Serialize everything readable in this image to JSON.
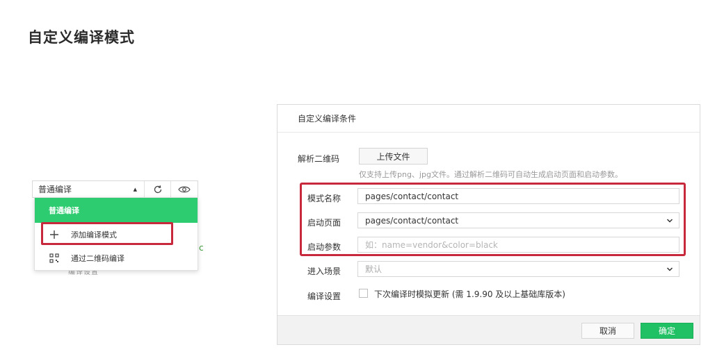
{
  "slide": {
    "title": "自定义编译模式"
  },
  "mini_toolbar": {
    "select_value": "普通编译",
    "icons": [
      "caret-up-icon",
      "refresh-icon",
      "eye-icon"
    ]
  },
  "dropdown": {
    "items": [
      {
        "label": "普通编译",
        "icon": ""
      },
      {
        "label": "添加编译模式",
        "icon": "plus-icon"
      },
      {
        "label": "通过二维码编译",
        "icon": "qrcode-icon"
      }
    ],
    "behind_text": "编译设置",
    "behind_green": "c"
  },
  "dialog": {
    "title": "自定义编译条件",
    "qrcode": {
      "label": "解析二维码",
      "upload_label": "上传文件",
      "hint": "仅支持上传png、jpg文件。通过解析二维码可自动生成启动页面和启动参数。"
    },
    "mode_name": {
      "label": "模式名称",
      "value": "pages/contact/contact"
    },
    "start_page": {
      "label": "启动页面",
      "value": "pages/contact/contact"
    },
    "start_params": {
      "label": "启动参数",
      "placeholder": "如：name=vendor&color=black"
    },
    "scene": {
      "label": "进入场景",
      "value": "默认"
    },
    "compile_settings": {
      "label": "编译设置",
      "checkbox_label": "下次编译时模拟更新 (需 1.9.90 及以上基础库版本)"
    },
    "cancel_label": "取消",
    "ok_label": "确定"
  },
  "colors": {
    "accent_green": "#20c064",
    "highlight_red": "#c8283c"
  }
}
